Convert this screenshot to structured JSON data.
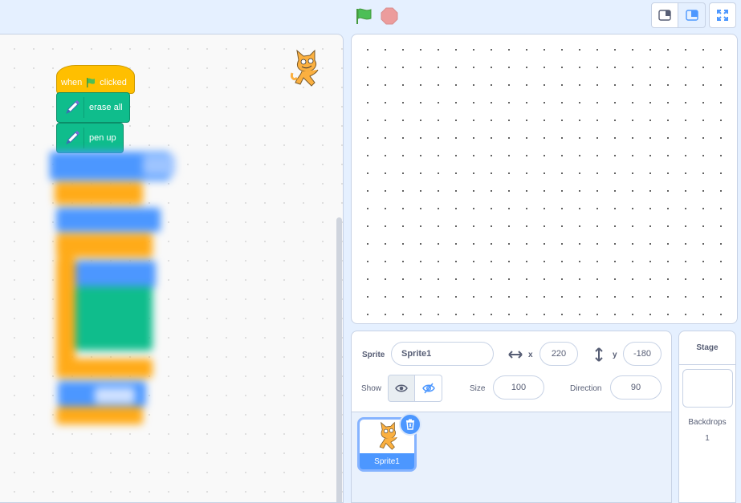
{
  "colors": {
    "motion_blue": "#4c97ff",
    "events_yellow": "#ffbf00",
    "pen_green": "#0fbd8c",
    "control_orange": "#ffab19",
    "stop_red": "#ec9c9c",
    "flag_green": "#4cbf56"
  },
  "controls": {
    "green_flag_icon": "green-flag-icon",
    "stop_icon": "stop-sign-icon",
    "layout_small": "small-stage-icon",
    "layout_large": "large-stage-icon",
    "fullscreen": "fullscreen-icon"
  },
  "code": {
    "hat": {
      "prefix": "when",
      "suffix": "clicked"
    },
    "blocks": [
      {
        "label": "erase all"
      },
      {
        "label": "pen up"
      }
    ]
  },
  "sprite_info": {
    "sprite_label": "Sprite",
    "sprite_name": "Sprite1",
    "x_label": "x",
    "x_value": "220",
    "y_label": "y",
    "y_value": "-180",
    "show_label": "Show",
    "size_label": "Size",
    "size_value": "100",
    "direction_label": "Direction",
    "direction_value": "90"
  },
  "sprites": [
    {
      "name": "Sprite1",
      "selected": true
    }
  ],
  "stage_panel": {
    "title": "Stage",
    "backdrops_label": "Backdrops",
    "backdrops_count": "1"
  }
}
